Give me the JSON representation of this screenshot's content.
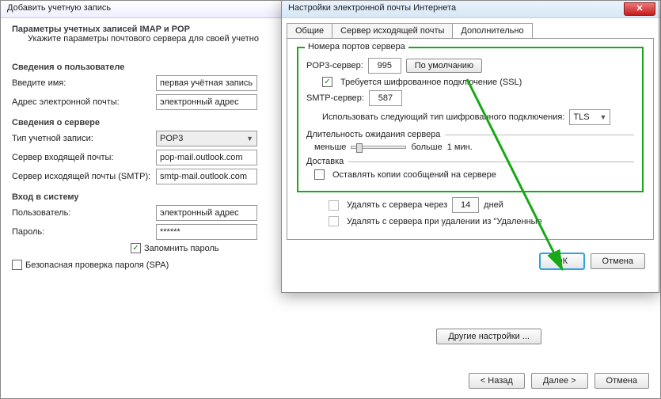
{
  "bgWin": {
    "title": "Добавить учетную запись",
    "heading": "Параметры учетных записей IMAP и POP",
    "sub": "Укажите параметры почтового сервера для своей учетно",
    "s1": "Сведения о пользователе",
    "name_l": "Введите имя:",
    "name_v": "первая учётная запись",
    "email_l": "Адрес электронной почты:",
    "email_v": "электронный адрес",
    "s2": "Сведения о сервере",
    "type_l": "Тип учетной записи:",
    "type_v": "POP3",
    "in_l": "Сервер входящей почты:",
    "in_v": "pop-mail.outlook.com",
    "out_l": "Сервер исходящей почты (SMTP):",
    "out_v": "smtp-mail.outlook.com",
    "s3": "Вход в систему",
    "user_l": "Пользователь:",
    "user_v": "электронный адрес",
    "pass_l": "Пароль:",
    "pass_v": "******",
    "remember": "Запомнить пароль",
    "spa": "Безопасная проверка пароля (SPA)",
    "more": "Другие настройки ...",
    "back": "< Назад",
    "next": "Далее >",
    "cancel": "Отмена"
  },
  "fgWin": {
    "title": "Настройки электронной почты Интернета",
    "tabs": {
      "general": "Общие",
      "outgoing": "Сервер исходящей почты",
      "advanced": "Дополнительно"
    },
    "ports_title": "Номера портов сервера",
    "pop_l": "POP3-сервер:",
    "pop_v": "995",
    "defaults": "По умолчанию",
    "ssl": "Требуется шифрованное подключение (SSL)",
    "smtp_l": "SMTP-сервер:",
    "smtp_v": "587",
    "enc_l": "Использовать следующий тип шифрованного подключения:",
    "enc_v": "TLS",
    "timeout_h": "Длительность ожидания сервера",
    "less": "меньше",
    "more": "больше",
    "tval": "1 мин.",
    "delivery_h": "Доставка",
    "leave": "Оставлять копии сообщений на сервере",
    "del_after": "Удалять с сервера через",
    "days_v": "14",
    "days_l": "дней",
    "del_trash": "Удалять с сервера при удалении из \"Удаленные",
    "ok": "ОК",
    "cancel": "Отмена"
  }
}
